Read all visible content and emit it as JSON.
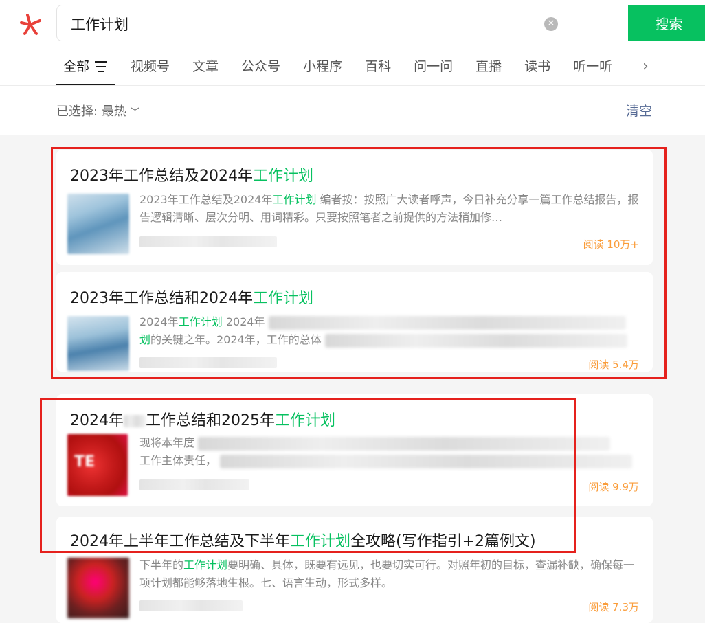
{
  "search": {
    "query": "工作计划",
    "button_label": "搜索"
  },
  "tabs": [
    {
      "label": "全部"
    },
    {
      "label": "视频号"
    },
    {
      "label": "文章"
    },
    {
      "label": "公众号"
    },
    {
      "label": "小程序"
    },
    {
      "label": "百科"
    },
    {
      "label": "问一问"
    },
    {
      "label": "直播"
    },
    {
      "label": "读书"
    },
    {
      "label": "听一听"
    }
  ],
  "filter": {
    "selected_prefix": "已选择:",
    "selected_value": "最热",
    "clear_label": "清空"
  },
  "results": [
    {
      "title_pre": "2023年工作总结及2024年",
      "title_hl": "工作计划",
      "title_post": "",
      "snippet_pre": "2023年工作总结及2024年",
      "snippet_hl": "工作计划",
      "snippet_post": " 编者按：按照广大读者呼声，今日补充分享一篇工作总结报告，报告逻辑清晰、层次分明、用词精彩。只要按照笔者之前提供的方法稍加修…",
      "reads": "阅读 10万+"
    },
    {
      "title_pre": "2023年工作总结和2024年",
      "title_hl": "工作计划",
      "title_post": "",
      "snippet_pre": "2024年",
      "snippet_hl": "工作计划",
      "snippet_mid": " 2024年",
      "snippet_line2_hl": "划",
      "snippet_line2": "的关键之年。2024年，工作的总体",
      "reads": "阅读 5.4万"
    },
    {
      "title_pre": "2024年",
      "title_mid": "工作总结和2025年",
      "title_hl": "工作计划",
      "snippet_pre": "现将本年度",
      "snippet_line2": "工作主体责任，",
      "reads": "阅读 9.9万"
    },
    {
      "title_pre": "2024年上半年工作总结及下半年",
      "title_hl": "工作计划",
      "title_post": "全攻略(写作指引+2篇例文)",
      "snippet_pre": "下半年的",
      "snippet_hl": "工作计划",
      "snippet_post": "要明确、具体，既要有远见，也要切实可行。对照年初的目标，查漏补缺，确保每一项计划都能够落地生根。七、语言生动，形式多样。",
      "reads": "阅读 7.3万"
    }
  ]
}
